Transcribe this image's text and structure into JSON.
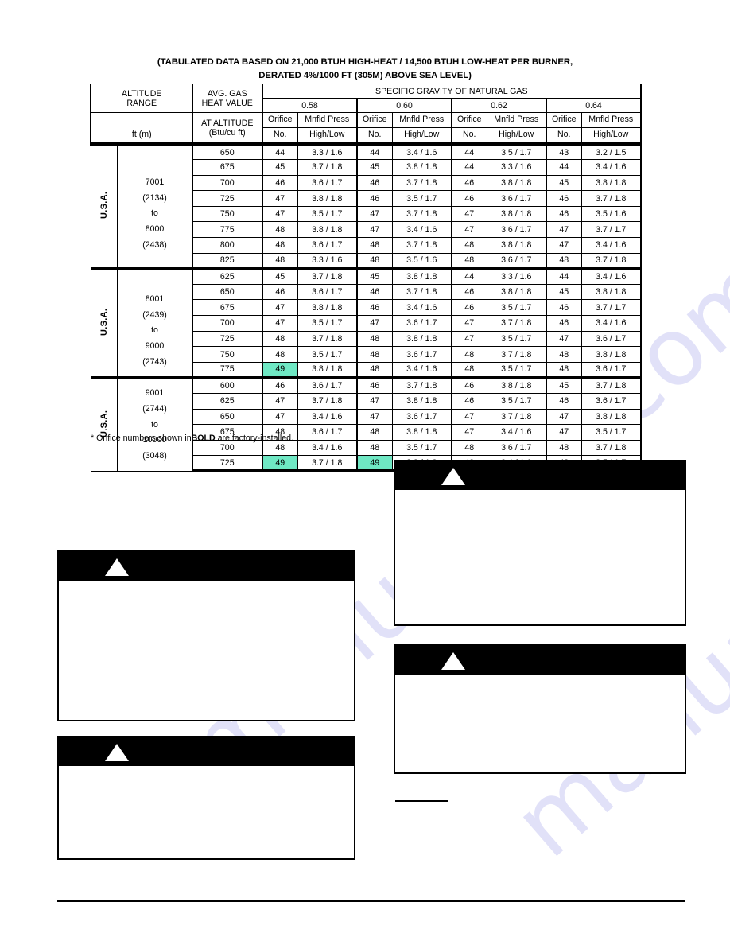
{
  "page": {
    "caption_line1": "(TABULATED DATA BASED ON 21,000 BTUH HIGH-HEAT / 14,500 BTUH LOW-HEAT PER BURNER,",
    "caption_line2": "DERATED 4%/1000 FT (305M) ABOVE SEA LEVEL)",
    "footnote_prefix": "* Orifice numbers shown in",
    "footnote_bold": "BOLD",
    "footnote_suffix": "are factory-installed.",
    "watermark_text": "manualslib.com",
    "highlight_color": "#6FE8C4"
  },
  "table": {
    "headers": {
      "altitude_l1": "ALTITUDE",
      "altitude_l2": "RANGE",
      "altitude_l3": "ft (m)",
      "avg_gas_l1": "AVG. GAS",
      "avg_gas_l2": "HEAT VALUE",
      "avg_gas_l3": "AT ALTITUDE",
      "avg_gas_l4": "(Btu/cu ft)",
      "specific_gravity": "SPECIFIC GRAVITY OF NATURAL GAS",
      "gravities": [
        "0.58",
        "0.60",
        "0.62",
        "0.64"
      ],
      "orifice_l1": "Orifice",
      "orifice_l2": "No.",
      "mnfld_l1": "Mnfld Press",
      "mnfld_l2": "High/Low"
    },
    "blocks": [
      {
        "country": "U.S.A.",
        "range_lines": [
          "7001",
          "(2134)",
          "to",
          "8000",
          "(2438)"
        ],
        "rows": [
          {
            "heat": "650",
            "cells": [
              {
                "orifice": "44",
                "press": "3.3 / 1.6",
                "bold": false,
                "hl": false
              },
              {
                "orifice": "44",
                "press": "3.4 / 1.6",
                "bold": false,
                "hl": false
              },
              {
                "orifice": "44",
                "press": "3.5 / 1.7",
                "bold": false,
                "hl": false
              },
              {
                "orifice": "43",
                "press": "3.2 / 1.5",
                "bold": true,
                "hl": false
              }
            ]
          },
          {
            "heat": "675",
            "cells": [
              {
                "orifice": "45",
                "press": "3.7 / 1.8",
                "bold": false,
                "hl": false
              },
              {
                "orifice": "45",
                "press": "3.8 / 1.8",
                "bold": false,
                "hl": false
              },
              {
                "orifice": "44",
                "press": "3.3 / 1.6",
                "bold": false,
                "hl": false
              },
              {
                "orifice": "44",
                "press": "3.4 / 1.6",
                "bold": false,
                "hl": false
              }
            ]
          },
          {
            "heat": "700",
            "cells": [
              {
                "orifice": "46",
                "press": "3.6 / 1.7",
                "bold": false,
                "hl": false
              },
              {
                "orifice": "46",
                "press": "3.7 / 1.8",
                "bold": false,
                "hl": false
              },
              {
                "orifice": "46",
                "press": "3.8 / 1.8",
                "bold": false,
                "hl": false
              },
              {
                "orifice": "45",
                "press": "3.8 / 1.8",
                "bold": false,
                "hl": false
              }
            ]
          },
          {
            "heat": "725",
            "cells": [
              {
                "orifice": "47",
                "press": "3.8 / 1.8",
                "bold": false,
                "hl": false
              },
              {
                "orifice": "46",
                "press": "3.5 / 1.7",
                "bold": false,
                "hl": false
              },
              {
                "orifice": "46",
                "press": "3.6 / 1.7",
                "bold": false,
                "hl": false
              },
              {
                "orifice": "46",
                "press": "3.7 / 1.8",
                "bold": false,
                "hl": false
              }
            ]
          },
          {
            "heat": "750",
            "cells": [
              {
                "orifice": "47",
                "press": "3.5 / 1.7",
                "bold": false,
                "hl": false
              },
              {
                "orifice": "47",
                "press": "3.7 / 1.8",
                "bold": false,
                "hl": false
              },
              {
                "orifice": "47",
                "press": "3.8 / 1.8",
                "bold": false,
                "hl": false
              },
              {
                "orifice": "46",
                "press": "3.5 / 1.6",
                "bold": false,
                "hl": false
              }
            ]
          },
          {
            "heat": "775",
            "cells": [
              {
                "orifice": "48",
                "press": "3.8 / 1.8",
                "bold": false,
                "hl": false
              },
              {
                "orifice": "47",
                "press": "3.4 / 1.6",
                "bold": false,
                "hl": false
              },
              {
                "orifice": "47",
                "press": "3.6 / 1.7",
                "bold": false,
                "hl": false
              },
              {
                "orifice": "47",
                "press": "3.7 / 1.7",
                "bold": false,
                "hl": false
              }
            ]
          },
          {
            "heat": "800",
            "cells": [
              {
                "orifice": "48",
                "press": "3.6 / 1.7",
                "bold": false,
                "hl": false
              },
              {
                "orifice": "48",
                "press": "3.7 / 1.8",
                "bold": false,
                "hl": false
              },
              {
                "orifice": "48",
                "press": "3.8 / 1.8",
                "bold": false,
                "hl": false
              },
              {
                "orifice": "47",
                "press": "3.4 / 1.6",
                "bold": false,
                "hl": false
              }
            ]
          },
          {
            "heat": "825",
            "cells": [
              {
                "orifice": "48",
                "press": "3.3 / 1.6",
                "bold": false,
                "hl": false
              },
              {
                "orifice": "48",
                "press": "3.5 / 1.6",
                "bold": false,
                "hl": false
              },
              {
                "orifice": "48",
                "press": "3.6 / 1.7",
                "bold": false,
                "hl": false
              },
              {
                "orifice": "48",
                "press": "3.7 / 1.8",
                "bold": false,
                "hl": false
              }
            ]
          }
        ]
      },
      {
        "country": "U.S.A.",
        "range_lines": [
          "8001",
          "(2439)",
          "to",
          "9000",
          "(2743)"
        ],
        "rows": [
          {
            "heat": "625",
            "cells": [
              {
                "orifice": "45",
                "press": "3.7 / 1.8",
                "bold": false,
                "hl": false
              },
              {
                "orifice": "45",
                "press": "3.8 / 1.8",
                "bold": false,
                "hl": false
              },
              {
                "orifice": "44",
                "press": "3.3 / 1.6",
                "bold": false,
                "hl": false
              },
              {
                "orifice": "44",
                "press": "3.4 / 1.6",
                "bold": false,
                "hl": false
              }
            ]
          },
          {
            "heat": "650",
            "cells": [
              {
                "orifice": "46",
                "press": "3.6 / 1.7",
                "bold": false,
                "hl": false
              },
              {
                "orifice": "46",
                "press": "3.7 / 1.8",
                "bold": false,
                "hl": false
              },
              {
                "orifice": "46",
                "press": "3.8 / 1.8",
                "bold": false,
                "hl": false
              },
              {
                "orifice": "45",
                "press": "3.8 / 1.8",
                "bold": false,
                "hl": false
              }
            ]
          },
          {
            "heat": "675",
            "cells": [
              {
                "orifice": "47",
                "press": "3.8 / 1.8",
                "bold": false,
                "hl": false
              },
              {
                "orifice": "46",
                "press": "3.4 / 1.6",
                "bold": false,
                "hl": false
              },
              {
                "orifice": "46",
                "press": "3.5 / 1.7",
                "bold": false,
                "hl": false
              },
              {
                "orifice": "46",
                "press": "3.7 / 1.7",
                "bold": false,
                "hl": false
              }
            ]
          },
          {
            "heat": "700",
            "cells": [
              {
                "orifice": "47",
                "press": "3.5 / 1.7",
                "bold": false,
                "hl": false
              },
              {
                "orifice": "47",
                "press": "3.6 / 1.7",
                "bold": false,
                "hl": false
              },
              {
                "orifice": "47",
                "press": "3.7 / 1.8",
                "bold": false,
                "hl": false
              },
              {
                "orifice": "46",
                "press": "3.4 / 1.6",
                "bold": false,
                "hl": false
              }
            ]
          },
          {
            "heat": "725",
            "cells": [
              {
                "orifice": "48",
                "press": "3.7 / 1.8",
                "bold": false,
                "hl": false
              },
              {
                "orifice": "48",
                "press": "3.8 / 1.8",
                "bold": false,
                "hl": false
              },
              {
                "orifice": "47",
                "press": "3.5 / 1.7",
                "bold": false,
                "hl": false
              },
              {
                "orifice": "47",
                "press": "3.6 / 1.7",
                "bold": false,
                "hl": false
              }
            ]
          },
          {
            "heat": "750",
            "cells": [
              {
                "orifice": "48",
                "press": "3.5 / 1.7",
                "bold": false,
                "hl": false
              },
              {
                "orifice": "48",
                "press": "3.6 / 1.7",
                "bold": false,
                "hl": false
              },
              {
                "orifice": "48",
                "press": "3.7 / 1.8",
                "bold": false,
                "hl": false
              },
              {
                "orifice": "48",
                "press": "3.8 / 1.8",
                "bold": false,
                "hl": false
              }
            ]
          },
          {
            "heat": "775",
            "cells": [
              {
                "orifice": "49",
                "press": "3.8 / 1.8",
                "bold": false,
                "hl": true
              },
              {
                "orifice": "48",
                "press": "3.4 / 1.6",
                "bold": false,
                "hl": false
              },
              {
                "orifice": "48",
                "press": "3.5 / 1.7",
                "bold": false,
                "hl": false
              },
              {
                "orifice": "48",
                "press": "3.6 / 1.7",
                "bold": false,
                "hl": false
              }
            ]
          }
        ]
      },
      {
        "country": "U.S.A.",
        "range_lines": [
          "9001",
          "(2744)",
          "to",
          "10000",
          "(3048)"
        ],
        "rows": [
          {
            "heat": "600",
            "cells": [
              {
                "orifice": "46",
                "press": "3.6 / 1.7",
                "bold": false,
                "hl": false
              },
              {
                "orifice": "46",
                "press": "3.7 / 1.8",
                "bold": false,
                "hl": false
              },
              {
                "orifice": "46",
                "press": "3.8 / 1.8",
                "bold": false,
                "hl": false
              },
              {
                "orifice": "45",
                "press": "3.7 / 1.8",
                "bold": false,
                "hl": false
              }
            ]
          },
          {
            "heat": "625",
            "cells": [
              {
                "orifice": "47",
                "press": "3.7 / 1.8",
                "bold": false,
                "hl": false
              },
              {
                "orifice": "47",
                "press": "3.8 / 1.8",
                "bold": false,
                "hl": false
              },
              {
                "orifice": "46",
                "press": "3.5 / 1.7",
                "bold": false,
                "hl": false
              },
              {
                "orifice": "46",
                "press": "3.6 / 1.7",
                "bold": false,
                "hl": false
              }
            ]
          },
          {
            "heat": "650",
            "cells": [
              {
                "orifice": "47",
                "press": "3.4 / 1.6",
                "bold": false,
                "hl": false
              },
              {
                "orifice": "47",
                "press": "3.6 / 1.7",
                "bold": false,
                "hl": false
              },
              {
                "orifice": "47",
                "press": "3.7 / 1.8",
                "bold": false,
                "hl": false
              },
              {
                "orifice": "47",
                "press": "3.8 / 1.8",
                "bold": false,
                "hl": false
              }
            ]
          },
          {
            "heat": "675",
            "cells": [
              {
                "orifice": "48",
                "press": "3.6 / 1.7",
                "bold": false,
                "hl": false
              },
              {
                "orifice": "48",
                "press": "3.8 / 1.8",
                "bold": false,
                "hl": false
              },
              {
                "orifice": "47",
                "press": "3.4 / 1.6",
                "bold": false,
                "hl": false
              },
              {
                "orifice": "47",
                "press": "3.5 / 1.7",
                "bold": false,
                "hl": false
              }
            ]
          },
          {
            "heat": "700",
            "cells": [
              {
                "orifice": "48",
                "press": "3.4 / 1.6",
                "bold": false,
                "hl": false
              },
              {
                "orifice": "48",
                "press": "3.5 / 1.7",
                "bold": false,
                "hl": false
              },
              {
                "orifice": "48",
                "press": "3.6 / 1.7",
                "bold": false,
                "hl": false
              },
              {
                "orifice": "48",
                "press": "3.7 / 1.8",
                "bold": false,
                "hl": false
              }
            ]
          },
          {
            "heat": "725",
            "cells": [
              {
                "orifice": "49",
                "press": "3.7 / 1.8",
                "bold": false,
                "hl": true
              },
              {
                "orifice": "49",
                "press": "3.8 / 1.8",
                "bold": false,
                "hl": true
              },
              {
                "orifice": "48",
                "press": "3.4 / 1.6",
                "bold": false,
                "hl": false
              },
              {
                "orifice": "48",
                "press": "3.5 / 1.7",
                "bold": false,
                "hl": false
              }
            ]
          }
        ]
      }
    ]
  },
  "warning_boxes": [
    {
      "id": "right-1",
      "body_text": ""
    },
    {
      "id": "right-2",
      "body_text": ""
    },
    {
      "id": "left-1",
      "body_text": ""
    },
    {
      "id": "left-2",
      "body_text": ""
    }
  ]
}
